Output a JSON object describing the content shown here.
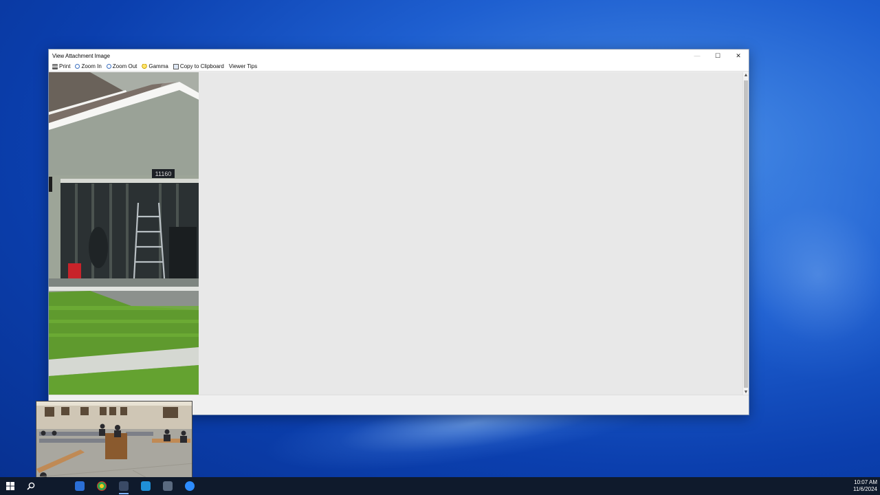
{
  "window": {
    "title": "View Attachment Image",
    "controls": {
      "minimize": "—",
      "maximize": "☐",
      "close": "✕"
    }
  },
  "toolbar": {
    "items": [
      {
        "label": "Print",
        "icon": "print-icon"
      },
      {
        "label": "Zoom In",
        "icon": "zoom-in-icon"
      },
      {
        "label": "Zoom Out",
        "icon": "zoom-out-icon"
      },
      {
        "label": "Gamma",
        "icon": "lightbulb-icon"
      },
      {
        "label": "Copy to Clipboard",
        "icon": "clipboard-icon"
      },
      {
        "label": "Viewer Tips",
        "icon": ""
      }
    ]
  },
  "photo": {
    "house_number": "11160"
  },
  "taskbar": {
    "time": "10:07 AM",
    "date": "11/6/2024"
  },
  "colors": {
    "desktop": "#1e5fd0",
    "taskbar": "#0f1a2c",
    "viewer_background": "#e8e8e8"
  }
}
